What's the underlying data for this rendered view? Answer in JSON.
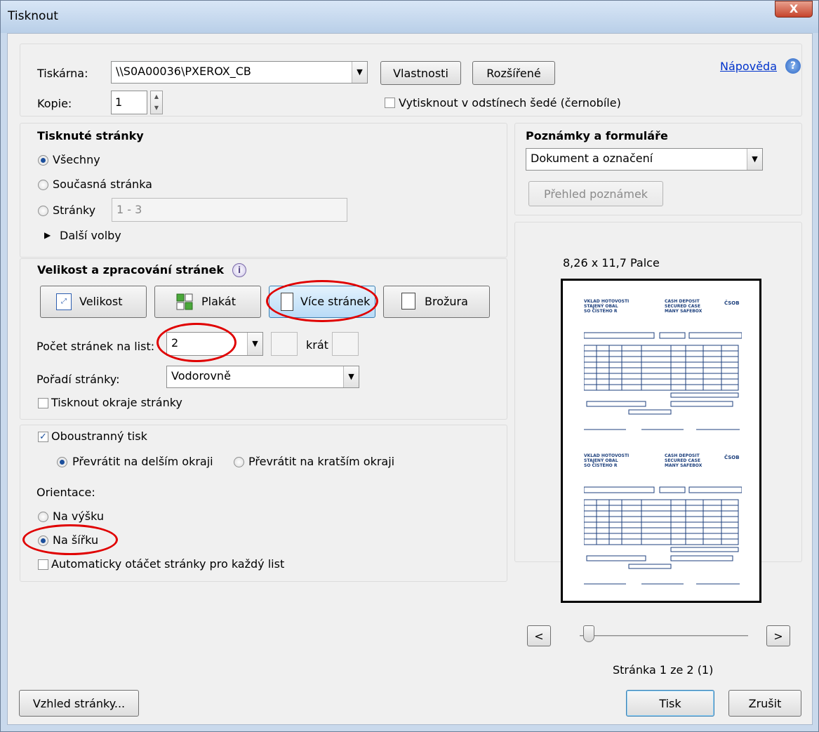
{
  "window": {
    "title": "Tisknout",
    "close_label": "X"
  },
  "printer": {
    "label": "Tiskárna:",
    "value": "\\\\S0A00036\\PXEROX_CB",
    "properties_button": "Vlastnosti",
    "advanced_button": "Rozšířené",
    "help_link": "Nápověda",
    "copies_label": "Kopie:",
    "copies_value": "1",
    "grayscale_label": "Vytisknout v odstínech šedé (černobíle)"
  },
  "pages": {
    "heading": "Tisknuté stránky",
    "all": "Všechny",
    "current": "Současná stránka",
    "range_label": "Stránky",
    "range_value": "1 - 3",
    "more_options": "Další volby"
  },
  "notes": {
    "heading": "Poznámky a formuláře",
    "select_value": "Dokument a označení",
    "summary_button": "Přehled poznámek"
  },
  "sizing": {
    "heading": "Velikost a zpracování stránek",
    "buttons": [
      "Velikost",
      "Plakát",
      "Více stránek",
      "Brožura"
    ],
    "pages_per_sheet_label": "Počet stránek na list:",
    "pages_per_sheet_value": "2",
    "times_label": "krát",
    "order_label": "Pořadí stránky:",
    "order_value": "Vodorovně",
    "print_borders": "Tisknout okraje stránky"
  },
  "duplex": {
    "label": "Oboustranný tisk",
    "long_edge": "Převrátit na delším okraji",
    "short_edge": "Převrátit na kratším okraji",
    "orientation_label": "Orientace:",
    "portrait": "Na výšku",
    "landscape": "Na šířku",
    "auto_rotate": "Automaticky otáčet stránky pro každý list"
  },
  "preview": {
    "size_label": "8,26 x 11,7 Palce",
    "slip": {
      "title_cz": "VKLAD HOTOVOSTI",
      "sub_cz_1": "STAJENÝ OBAL",
      "sub_cz_2": "SO ČÍSTÉHO R",
      "title_en": "CASH DEPOSIT",
      "sub_en_1": "SECURED CASE",
      "sub_en_2": "MANY SAFEBOX",
      "logo": "ČSOB"
    },
    "prev_button": "<",
    "next_button": ">",
    "page_status": "Stránka 1 ze 2 (1)"
  },
  "footer": {
    "page_setup_button": "Vzhled stránky...",
    "print_button": "Tisk",
    "cancel_button": "Zrušit"
  },
  "colors": {
    "accent": "#1c4f9c",
    "highlight_ring": "#e00000"
  }
}
